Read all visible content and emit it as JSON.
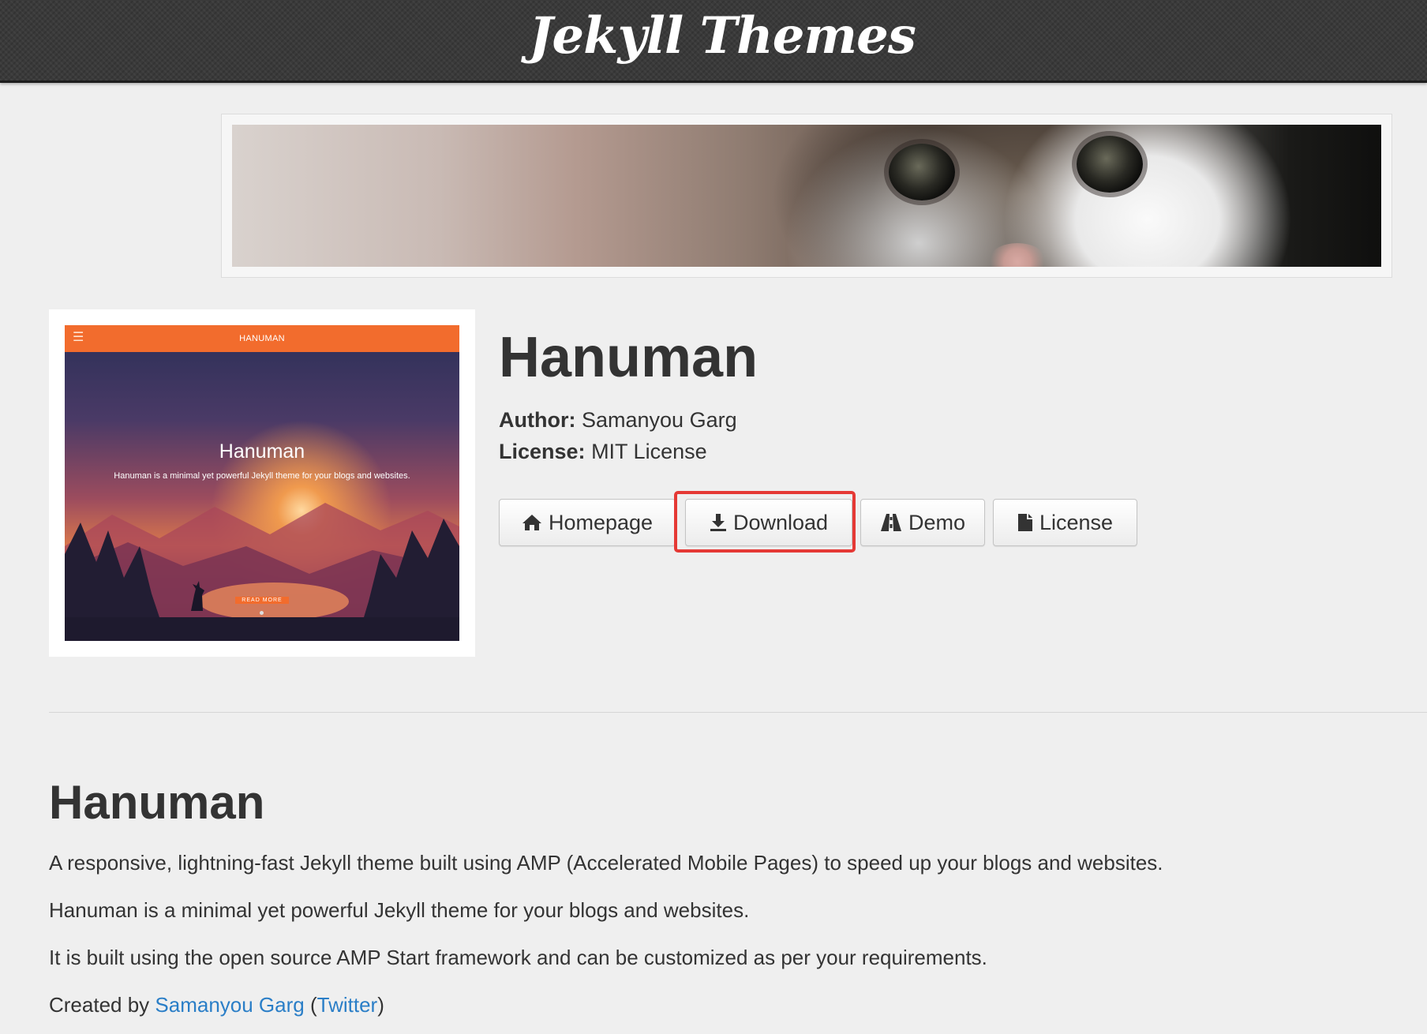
{
  "header": {
    "site_title": "Jekyll Themes"
  },
  "banner": {
    "image": "kitten-photo"
  },
  "thumbnail": {
    "menu_icon": "☰",
    "logo_text": "HANUMAN",
    "heading": "Hanuman",
    "subtitle": "Hanuman is a minimal yet powerful Jekyll theme for your blogs and websites.",
    "cta_label": "READ MORE"
  },
  "theme": {
    "name": "Hanuman",
    "author_label": "Author:",
    "author_value": "Samanyou Garg",
    "license_label": "License:",
    "license_value": "MIT License"
  },
  "buttons": {
    "homepage": {
      "label": "Homepage",
      "icon": "home-icon"
    },
    "download": {
      "label": "Download",
      "icon": "download-icon"
    },
    "demo": {
      "label": "Demo",
      "icon": "road-icon"
    },
    "license": {
      "label": "License",
      "icon": "file-icon"
    }
  },
  "highlight_color": "#e53935",
  "link_color": "#2a7ec7",
  "readme": {
    "title": "Hanuman",
    "p1": "A responsive, lightning-fast Jekyll theme built using AMP (Accelerated Mobile Pages) to speed up your blogs and websites.",
    "p2": "Hanuman is a minimal yet powerful Jekyll theme for your blogs and websites.",
    "p3": "It is built using the open source AMP Start framework and can be customized as per your requirements.",
    "p4_prefix": "Created by ",
    "p4_author_link": "Samanyou Garg",
    "p4_paren_open": " (",
    "p4_twitter_link": "Twitter",
    "p4_paren_close": ")"
  }
}
